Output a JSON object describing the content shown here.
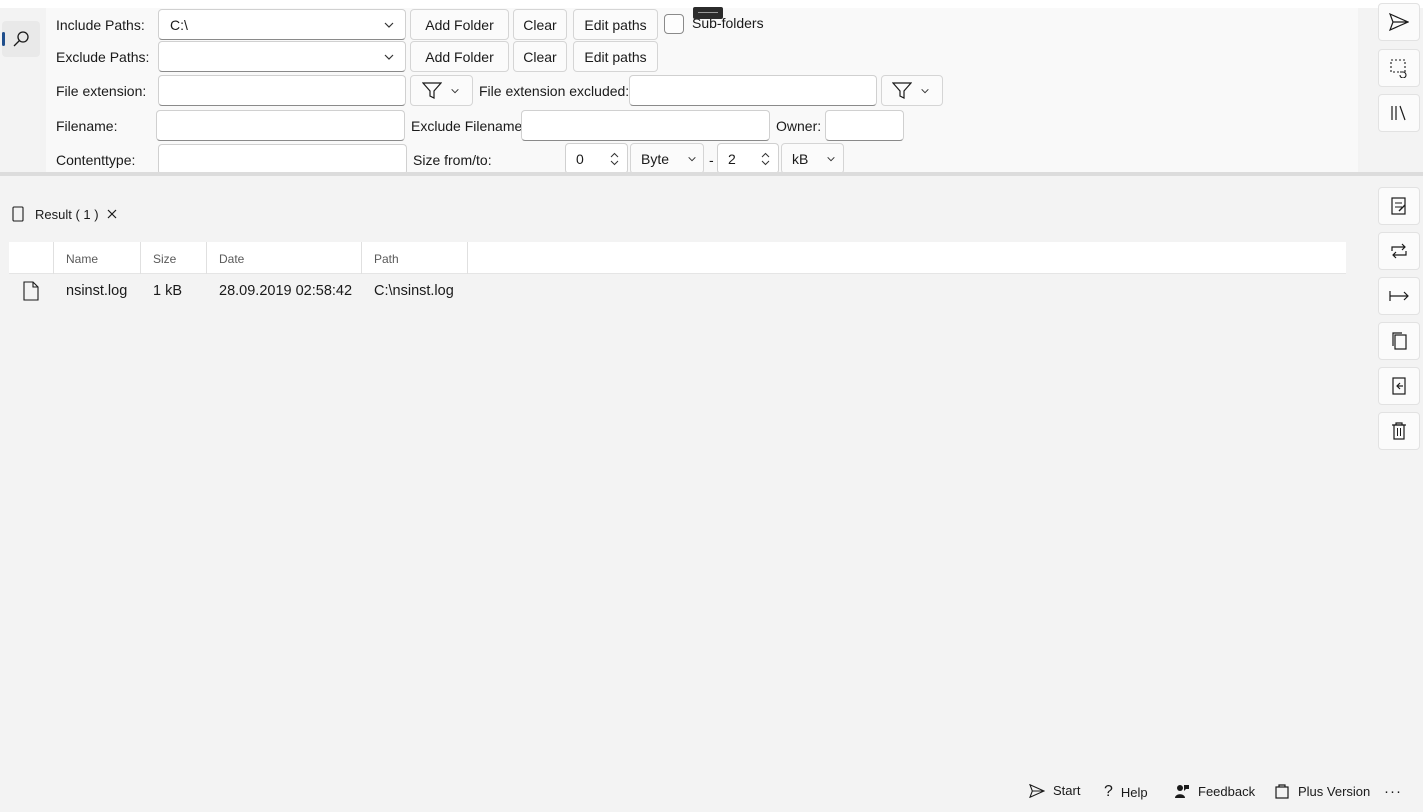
{
  "search_form": {
    "include_paths_label": "Include Paths:",
    "include_paths_value": "C:\\",
    "exclude_paths_label": "Exclude Paths:",
    "exclude_paths_value": "",
    "add_folder_label": "Add Folder",
    "clear_label": "Clear",
    "edit_paths_label": "Edit paths",
    "subfolders_label": "Sub-folders",
    "subfolders_checked": false,
    "file_extension_label": "File extension:",
    "file_extension_value": "",
    "file_extension_excluded_label": "File extension excluded:",
    "file_extension_excluded_value": "",
    "filename_label": "Filename:",
    "filename_value": "",
    "exclude_filename_label": "Exclude Filename:",
    "exclude_filename_value": "",
    "owner_label": "Owner:",
    "owner_value": "",
    "contenttype_label": "Contenttype:",
    "contenttype_value": "",
    "size_label": "Size from/to:",
    "size_from": "0",
    "size_from_unit": "Byte",
    "size_separator": "-",
    "size_to": "2",
    "size_to_unit": "kB"
  },
  "results": {
    "tab_label": "Result ( 1 )",
    "columns": [
      "Name",
      "Size",
      "Date",
      "Path"
    ],
    "rows": [
      {
        "name": "nsinst.log",
        "size": "1 kB",
        "date": "28.09.2019 02:58:42",
        "path": "C:\\nsinst.log"
      }
    ]
  },
  "command_bar": {
    "start_label": "Start",
    "help_label": "Help",
    "feedback_label": "Feedback",
    "plus_label": "Plus Version",
    "more_label": "···"
  },
  "colors": {
    "accent": "#1f4e8c",
    "background": "#f3f3f3",
    "panel": "#f9f9f9"
  }
}
